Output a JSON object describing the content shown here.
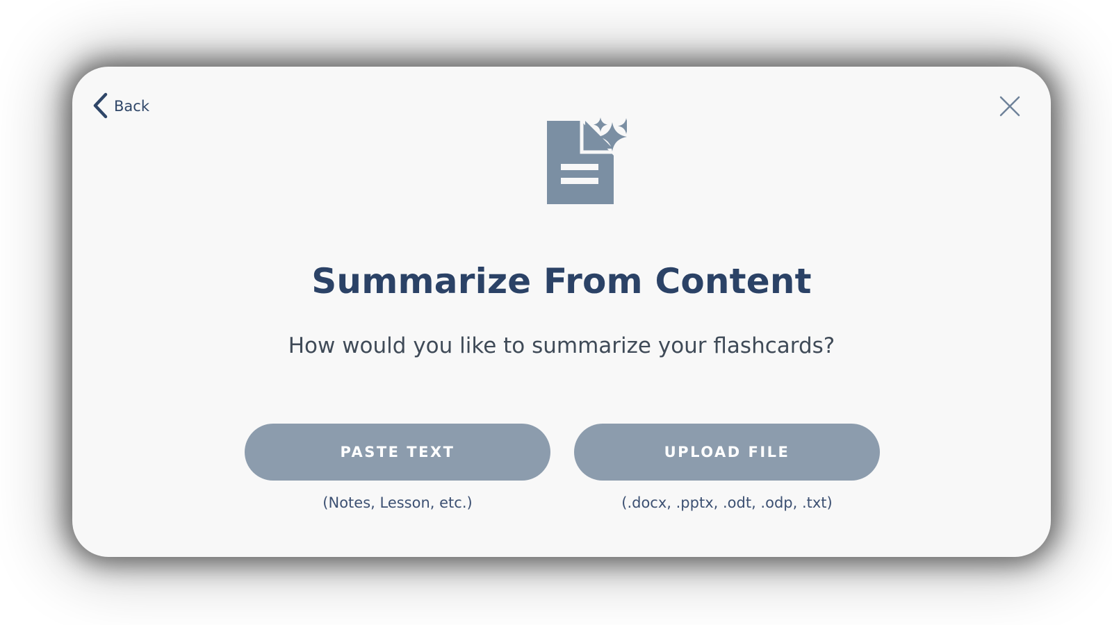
{
  "back": {
    "label": "Back"
  },
  "close": {
    "icon": "close-icon"
  },
  "hero": {
    "icon": "document-sparkles-icon",
    "color": "#7b8fa3"
  },
  "title": "Summarize From Content",
  "subtitle": "How would you like to summarize your flashcards?",
  "options": [
    {
      "label": "PASTE TEXT",
      "hint": "(Notes, Lesson, etc.)"
    },
    {
      "label": "UPLOAD FILE",
      "hint": "(.docx, .pptx, .odt, .odp, .txt)"
    }
  ],
  "colors": {
    "button_bg": "#8c9cad",
    "title": "#2b4266",
    "modal_bg": "#f8f8f8"
  }
}
